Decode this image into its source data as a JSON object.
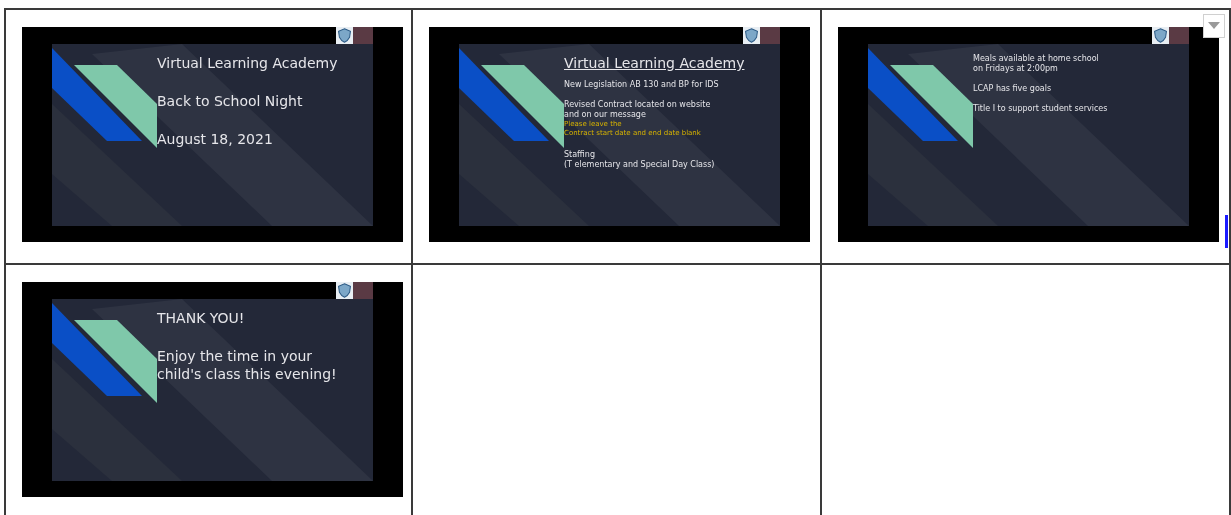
{
  "table": {
    "rows": [
      [
        {
          "kind": "slide",
          "paragraphs": [
            {
              "kind": "heading",
              "lines": [
                "Virtual Learning Academy"
              ]
            },
            {
              "kind": "heading",
              "lines": [
                "Back to School Night"
              ]
            },
            {
              "kind": "heading",
              "lines": [
                "August 18, 2021"
              ]
            }
          ]
        },
        {
          "kind": "slide",
          "paragraphs": [
            {
              "kind": "title",
              "lines": [
                "Virtual Learning Academy"
              ]
            },
            {
              "kind": "body",
              "lines": [
                "New Legislation AB 130 and BP for IDS"
              ]
            },
            {
              "kind": "body",
              "lines": [
                "Revised Contract located on website",
                "and on our message"
              ]
            },
            {
              "kind": "note",
              "lines": [
                "Please leave the",
                "Contract start date and end date blank"
              ]
            },
            {
              "kind": "body",
              "lines": [
                "Staffing",
                "(T elementary and Special Day Class)"
              ]
            }
          ]
        },
        {
          "kind": "slide",
          "paragraphs": [
            {
              "kind": "body",
              "lines": [
                "Meals available at home school",
                "on Fridays at 2:00pm"
              ]
            },
            {
              "kind": "body",
              "lines": [
                "LCAP has five goals"
              ]
            },
            {
              "kind": "body",
              "lines": [
                "Title I to support student services"
              ]
            }
          ]
        }
      ],
      [
        {
          "kind": "slide",
          "paragraphs": [
            {
              "kind": "heading",
              "lines": [
                "THANK YOU!"
              ]
            },
            {
              "kind": "heading",
              "lines": [
                "Enjoy the time in your",
                "child's class this evening!"
              ]
            }
          ]
        },
        {
          "kind": "empty"
        },
        {
          "kind": "empty"
        }
      ]
    ]
  }
}
